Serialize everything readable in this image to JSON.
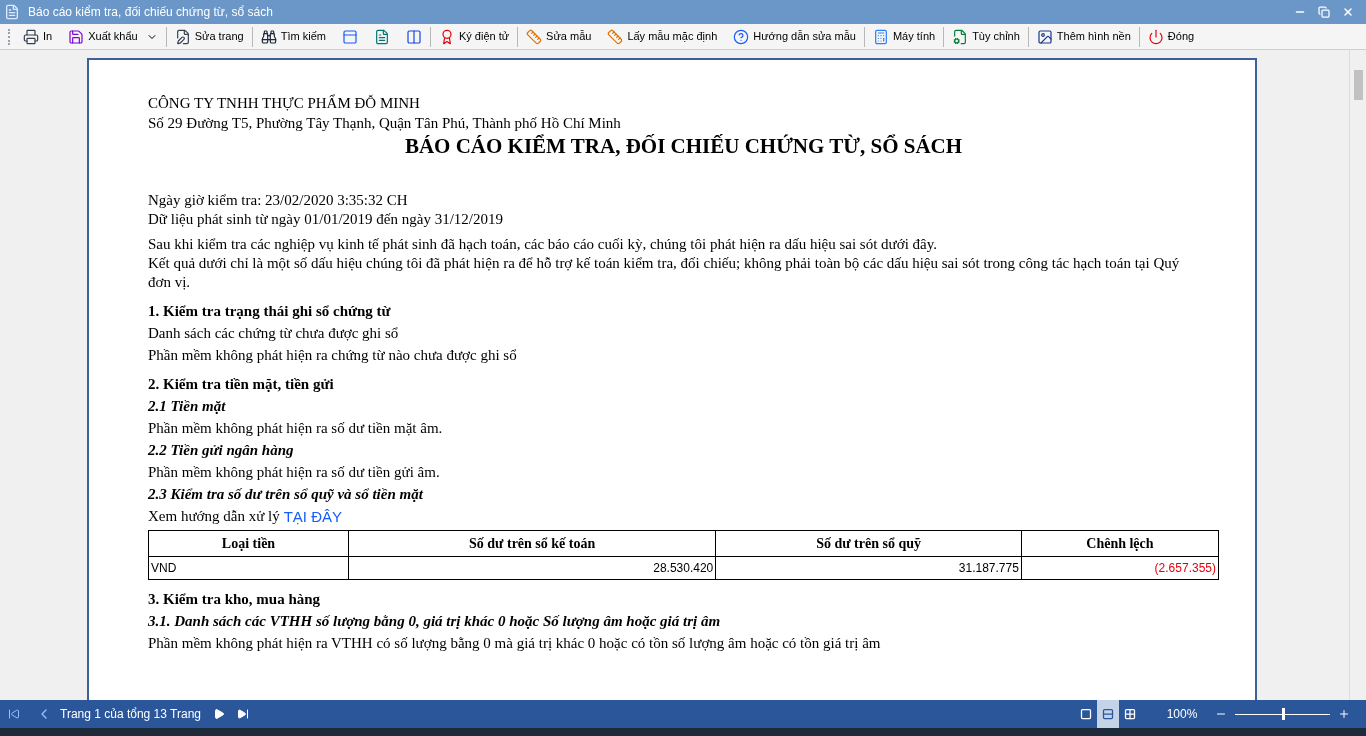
{
  "window": {
    "title": "Báo cáo kiểm tra, đối chiếu chứng từ, sổ sách"
  },
  "toolbar": {
    "groups": [
      [
        {
          "label": "In",
          "kind": "button"
        },
        {
          "label": "Xuất khẩu",
          "kind": "dropdown"
        }
      ],
      [
        {
          "label": "Sửa trang",
          "kind": "button"
        }
      ],
      [
        {
          "label": "Tìm kiếm",
          "kind": "button"
        },
        {
          "kind": "icon"
        },
        {
          "kind": "icon"
        },
        {
          "kind": "icon"
        }
      ],
      [
        {
          "label": "Ký điện tử",
          "kind": "button"
        }
      ],
      [
        {
          "label": "Sửa mẫu",
          "kind": "button"
        },
        {
          "label": "Lấy mẫu mặc định",
          "kind": "button"
        },
        {
          "label": "Hướng dẫn sửa mẫu",
          "kind": "button"
        }
      ],
      [
        {
          "label": "Máy tính",
          "kind": "button"
        }
      ],
      [
        {
          "label": "Tùy chỉnh",
          "kind": "button"
        }
      ],
      [
        {
          "label": "Thêm hình nền",
          "kind": "button"
        }
      ],
      [
        {
          "label": "Đóng",
          "kind": "button"
        }
      ]
    ]
  },
  "report": {
    "blocks": [
      {
        "kind": "company",
        "text": "CÔNG TY TNHH THỰC PHẨM ĐỖ MINH"
      },
      {
        "kind": "address",
        "text": "Số 29 Đường T5, Phường Tây Thạnh, Quận Tân Phú, Thành phố Hồ Chí Minh"
      },
      {
        "kind": "title",
        "text": "BÁO CÁO KIỂM TRA, ĐỐI CHIẾU CHỨNG TỪ, SỔ SÁCH"
      },
      {
        "kind": "meta",
        "text": "Ngày giờ kiểm tra: 23/02/2020 3:35:32 CH"
      },
      {
        "kind": "meta_line",
        "text": "Dữ liệu phát sinh từ ngày 01/01/2019 đến ngày 31/12/2019"
      },
      {
        "kind": "intro",
        "text": "Sau khi kiểm tra các nghiệp vụ kinh tế phát sinh đã hạch toán, các báo cáo cuối kỳ, chúng tôi phát hiện ra dấu hiệu sai sót dưới đây."
      },
      {
        "kind": "paragraph",
        "text": "Kết quả dưới chỉ là một số dấu hiệu chúng tôi đã phát hiện ra để hỗ trợ kế toán kiểm tra, đối chiếu; không phải toàn bộ các dấu hiệu sai sót trong công tác hạch toán tại Quý đơn vị."
      },
      {
        "kind": "heading",
        "text": "1. Kiểm tra trạng thái ghi sổ chứng từ"
      },
      {
        "kind": "text",
        "text": "Danh sách các chứng từ chưa được ghi sổ"
      },
      {
        "kind": "text",
        "text": "Phần mềm không phát hiện ra chứng từ nào chưa được ghi sổ"
      },
      {
        "kind": "heading",
        "text": "2. Kiểm tra tiền mặt, tiền gửi"
      },
      {
        "kind": "subheading",
        "text": "2.1 Tiền mặt"
      },
      {
        "kind": "text",
        "text": "Phần mềm không phát hiện ra số dư tiền mặt âm."
      },
      {
        "kind": "subheading",
        "text": "2.2 Tiền gửi ngân hàng"
      },
      {
        "kind": "text",
        "text": "Phần mềm không phát hiện ra số dư tiền gửi âm."
      },
      {
        "kind": "subheading",
        "text": "2.3 Kiểm tra số dư trên sổ quỹ và sổ tiền mặt"
      },
      {
        "kind": "link_line",
        "text": "Xem hướng dẫn xử lý",
        "link": "TẠI ĐÂY"
      },
      {
        "kind": "table",
        "columns": [
          "Loại tiền",
          "Số dư trên sổ kế toán",
          "Số dư trên sổ quỹ",
          "Chênh lệch"
        ],
        "rows": [
          {
            "currency": "VND",
            "book": "28.530.420",
            "fund": "31.187.775",
            "difference": "(2.657.355)",
            "negative": true
          }
        ]
      },
      {
        "kind": "heading",
        "text": "3. Kiểm tra kho, mua hàng"
      },
      {
        "kind": "subheading",
        "text": "3.1. Danh sách các VTHH số lượng bằng 0, giá trị khác 0 hoặc Số lượng âm hoặc giá trị âm"
      },
      {
        "kind": "text",
        "text": "Phần mềm không phát hiện ra VTHH có số lượng bằng 0 mà giá trị khác 0 hoặc có tồn số lượng âm hoặc có tồn giá trị âm"
      }
    ]
  },
  "status_bar": {
    "page_info": "Trang 1 của tổng 13 Trang",
    "view_modes": [
      {
        "selected": false
      },
      {
        "selected": true
      },
      {
        "selected": false
      }
    ],
    "zoom": "100%",
    "zoom_slider": {
      "level": 0.5
    }
  }
}
